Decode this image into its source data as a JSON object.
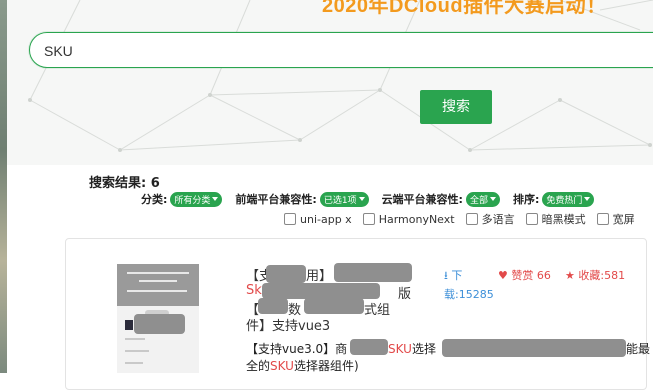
{
  "banner": {
    "title": "2020年DCloud插件大赛启动！"
  },
  "search": {
    "value": "SKU",
    "button_label": "搜索"
  },
  "results": {
    "count_label": "搜索结果: 6"
  },
  "filters": [
    {
      "label": "分类:",
      "value": "所有分类"
    },
    {
      "label": "前端平台兼容性:",
      "value": "已选1项"
    },
    {
      "label": "云端平台兼容性:",
      "value": "全部"
    },
    {
      "label": "排序:",
      "value": "免费热门"
    }
  ],
  "checkboxes": [
    {
      "label": "uni-app x",
      "checked": false
    },
    {
      "label": "HarmonyNext",
      "checked": false
    },
    {
      "label": "多语言",
      "checked": false
    },
    {
      "label": "暗黑模式",
      "checked": false
    },
    {
      "label": "宽屏",
      "checked": false
    }
  ],
  "plugin_card": {
    "title_line1_prefix": "【支",
    "title_line1_suffix": "用】",
    "title_line2_red": "Sk",
    "title_line2_rest": "版",
    "title_line3_prefix": "【",
    "title_line3_mid": "数",
    "title_line3_suffix": "式组",
    "title_line4": "件】支持vue3",
    "downloads_label": "下",
    "downloads_count": "载:15285",
    "likes_label": "赞赏 66",
    "favorites_label": "收藏:581",
    "desc_line1_prefix": "【支持vue3.0】商",
    "desc_line1_sku": "SKU",
    "desc_line1_mid": "选择",
    "desc_line1_suffix": "能最",
    "desc_line2_prefix": "全的",
    "desc_line2_sku": "SKU",
    "desc_line2_suffix": "选择器组件)"
  },
  "colors": {
    "accent": "#2aa44f",
    "banner": "#f39a1e",
    "highlight": "#e24a4a",
    "download": "#3d8fd8"
  }
}
